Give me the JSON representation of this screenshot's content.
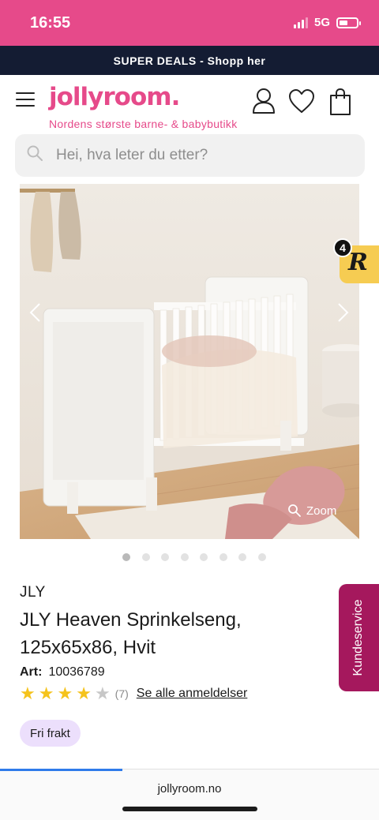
{
  "status_bar": {
    "time": "16:55",
    "network": "5G"
  },
  "promo": {
    "text": "SUPER DEALS - Shopp her"
  },
  "header": {
    "logo_text": "jollyroom.",
    "tagline": "Nordens største barne- & babybutikk"
  },
  "search": {
    "placeholder": "Hei, hva leter du etter?"
  },
  "gallery": {
    "image_count": 8,
    "active_index": 0,
    "zoom_label": "Zoom"
  },
  "badge": {
    "count": "4",
    "letter": "R"
  },
  "product": {
    "brand": "JLY",
    "title": "JLY Heaven Sprinkelseng, 125x65x86, Hvit",
    "art_label": "Art:",
    "art_number": "10036789",
    "rating": 4,
    "review_count": "(7)",
    "reviews_link": "Se alle anmeldelser",
    "free_shipping": "Fri frakt"
  },
  "customer_service": {
    "label": "Kundeservice"
  },
  "browser": {
    "url": "jollyroom.no"
  },
  "colors": {
    "brand_pink": "#e64a8a",
    "promo_navy": "#141c33",
    "customer_service": "#a5185d",
    "badge_yellow": "#f6cc52",
    "star": "#f5c31c",
    "tag_bg": "#ecdffc"
  }
}
